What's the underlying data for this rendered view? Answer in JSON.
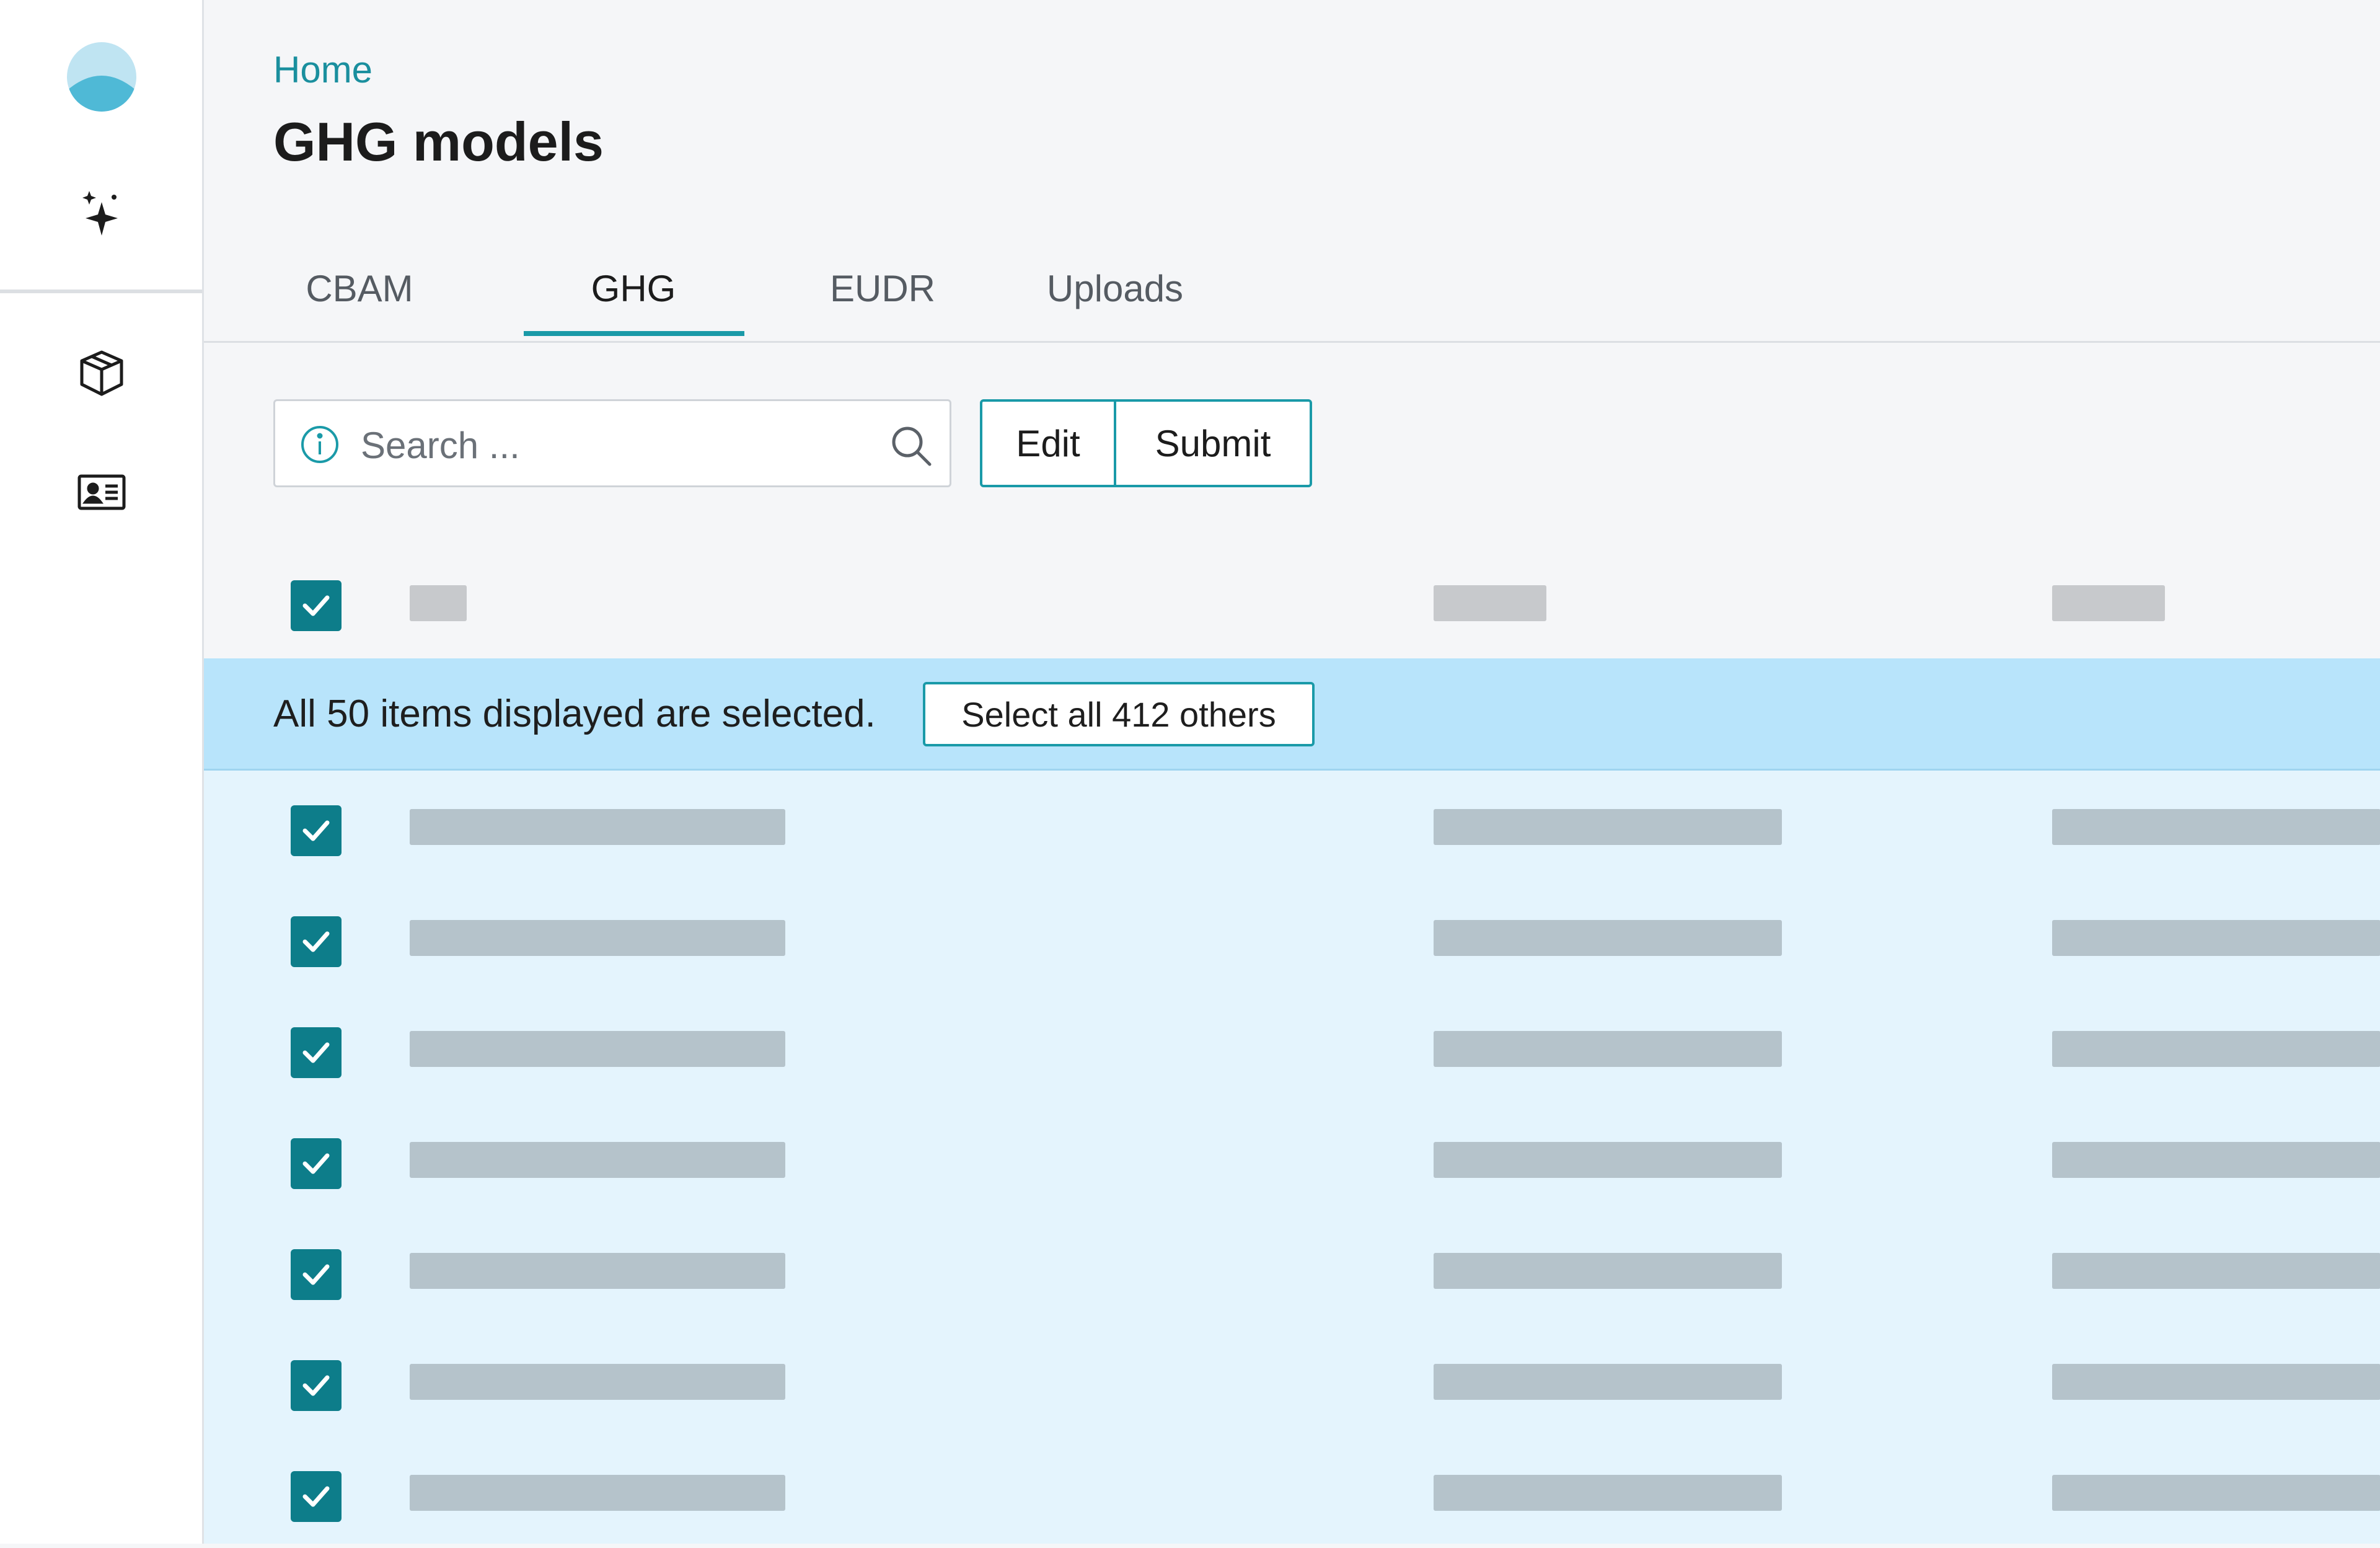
{
  "breadcrumb": {
    "home": "Home"
  },
  "page": {
    "title": "GHG models"
  },
  "tabs": [
    {
      "label": "CBAM",
      "active": false
    },
    {
      "label": "GHG",
      "active": true
    },
    {
      "label": "EUDR",
      "active": false
    },
    {
      "label": "Uploads",
      "active": false
    }
  ],
  "toolbar": {
    "search_placeholder": "Search ...",
    "search_value": "",
    "edit_label": "Edit",
    "submit_label": "Submit"
  },
  "selection": {
    "message": "All 50 items displayed are selected.",
    "select_all_label": "Select all 412 others"
  },
  "table": {
    "header_checked": true,
    "rows": [
      {
        "checked": true
      },
      {
        "checked": true
      },
      {
        "checked": true
      },
      {
        "checked": true
      },
      {
        "checked": true
      },
      {
        "checked": true
      },
      {
        "checked": true
      }
    ]
  },
  "sidebar": {
    "icons": [
      "logo-icon",
      "sparkle-icon",
      "package-icon",
      "contact-card-icon"
    ]
  },
  "colors": {
    "accent": "#1a9aa8",
    "checkbox": "#0d7d8a",
    "banner_bg": "#b8e4fb",
    "row_bg": "#e4f4fd"
  }
}
